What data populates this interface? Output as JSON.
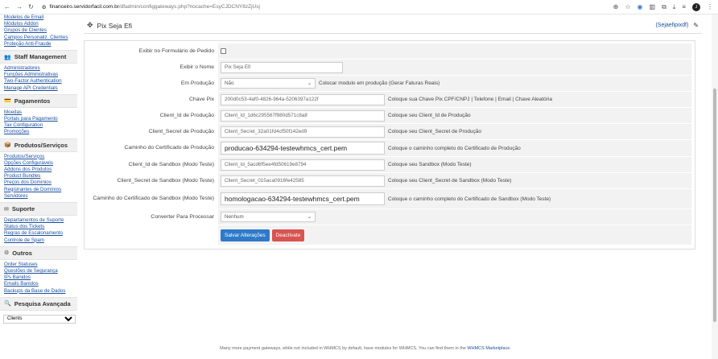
{
  "browser": {
    "url_domain": "financeiro.servidorfacil.com.br",
    "url_path": "/dfadmin/configgateways.php?nocache=EsyCJDCNY8zZjUsj",
    "avatar_initials": "J"
  },
  "sidebar": {
    "pre_links": [
      "Modelos de Email",
      "Módulos Addon",
      "Grupos de Clientes",
      "Campos Personaliz. Clientes",
      "Proteção Anti-Fraude"
    ],
    "sections": [
      {
        "title": "Staff Management",
        "icon": "users-icon",
        "links": [
          "Administradores",
          "Funções Administrativas",
          "Two-Factor Authentication",
          "Manage API Credentials"
        ]
      },
      {
        "title": "Pagamentos",
        "icon": "money-icon",
        "links": [
          "Moedas",
          "Portais para Pagamento",
          "Tax Configuration",
          "Promoções"
        ]
      },
      {
        "title": "Produtos/Serviços",
        "icon": "box-icon",
        "links": [
          "Produtos/Serviços",
          "Opções Configuráveis",
          "Addons dos Produtos",
          "Product Bundles",
          "Preços dos Domínios",
          "Registrantes de Domínios",
          "Servidores"
        ]
      },
      {
        "title": "Suporte",
        "icon": "support-icon",
        "links": [
          "Departamentos de Suporte",
          "Status dos Tickets",
          "Regras de Escalonamento",
          "Controle de Spam"
        ]
      },
      {
        "title": "Outros",
        "icon": "gear-icon",
        "links": [
          "Order Statuses",
          "Questões de Segurança",
          "IPs Banidos",
          "Emails Banidos",
          "Backups da Base de Dados"
        ]
      },
      {
        "title": "Pesquisa Avançada",
        "icon": "search-icon",
        "links": []
      }
    ],
    "search_select": "Clients"
  },
  "header": {
    "title": "Pix Seja Efi",
    "alias": "(Sejaefipixdf)"
  },
  "form": {
    "rows": [
      {
        "label": "Exibir no Formulário de Pedido",
        "type": "checkbox"
      },
      {
        "label": "Exibir o Nome",
        "type": "text",
        "value": "Pix Seja Efi",
        "width": 152
      },
      {
        "label": "Em Produção",
        "type": "select",
        "value": "Não",
        "width": 118,
        "help": "Colocar modulo em produção (Gerar Faturas Reais)"
      },
      {
        "label": "Chave Pix",
        "type": "text",
        "value": "200d0c53-4af0-4826-964a-5206397a122f",
        "width": 204,
        "help": "Coloque sua Chave Pix CPF/CNPJ | Telefone | Email | Chave Aleatória"
      },
      {
        "label": "Client_Id de Produção",
        "type": "text",
        "value": "Client_Id_1d6c295567f980d571c8a8",
        "width": 204,
        "help": "Coloque seu Client_Id de Produção"
      },
      {
        "label": "Client_Secret de Produção",
        "type": "text",
        "value": "Client_Secret_32a01fd4cf50f142ed9",
        "width": 204,
        "help": "Coloque seu Client_Secret de Produção"
      },
      {
        "label": "Caminho do Certificado de Produção",
        "type": "bigtext",
        "value": "producao-634294-testewhmcs_cert.pem",
        "width": 204,
        "help": "Coloque o caminho completo do Certificado de Produção"
      },
      {
        "label": "Client_Id de Sandbox (Modo Teste)",
        "type": "text",
        "value": "Client_Id_5acd6f5ee4fd50619e8794",
        "width": 204,
        "help": "Coloque seu Sandbox (Modo Teste)"
      },
      {
        "label": "Client_Secret de Sandbox (Modo Teste)",
        "type": "text",
        "value": "Client_Secret_015aca0916fe42585",
        "width": 204,
        "help": "Coloque seu Client_Secret de Sandbox (Modo Teste)"
      },
      {
        "label": "Caminho do Certificado de Sandbox (Modo Teste)",
        "type": "bigtext",
        "value": "homologacao-634294-testewhmcs_cert.pem",
        "width": 204,
        "help": "Coloque o caminho completo do Certificado de Sandbox (Modo Teste)",
        "tall": true
      },
      {
        "label": "Converter Para Processar",
        "type": "select",
        "value": "Nenhum",
        "width": 118
      },
      {
        "label": "",
        "type": "buttons"
      }
    ],
    "save_label": "Salvar Alterações",
    "deactivate_label": "Deactivate"
  },
  "footer": {
    "text": "Many more payment gateways, while not included in WHMCS by default, have modules for WHMCS. You can find them in the",
    "link": "WHMCS Marketplace",
    "end": "."
  }
}
